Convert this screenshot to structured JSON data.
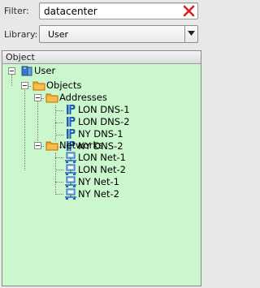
{
  "filter": {
    "label": "Filter:",
    "value": "datacenter"
  },
  "library": {
    "label": "Library:",
    "value": "User"
  },
  "tree_panel": {
    "header": "Object",
    "root": {
      "label": "User",
      "children": [
        {
          "label": "Objects",
          "children": [
            {
              "label": "Addresses",
              "children": [
                "LON DNS-1",
                "LON DNS-2",
                "NY DNS-1",
                "NY DNS-2"
              ]
            },
            {
              "label": "Networks",
              "children": [
                "LON Net-1",
                "LON Net-2",
                "NY Net-1",
                "NY Net-2"
              ]
            }
          ]
        }
      ]
    }
  },
  "colors": {
    "tree_background": "#ccf7cc",
    "clear_icon": "#d91e1e",
    "folder": "#f5a623",
    "host_icon": "#1f5fb8"
  }
}
